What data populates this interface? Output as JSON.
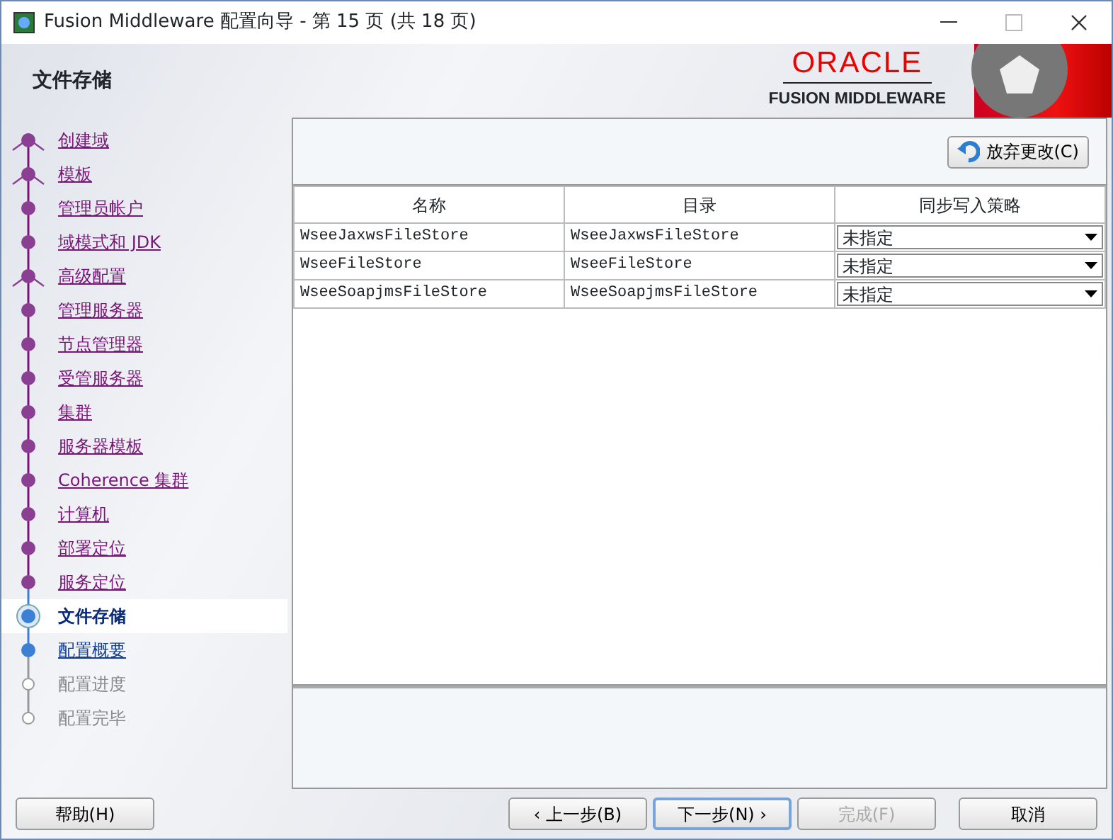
{
  "window": {
    "title": "Fusion Middleware 配置向导 - 第 15 页 (共 18 页)"
  },
  "header": {
    "title": "文件存储",
    "logo_brand": "ORACLE",
    "logo_product": "FUSION MIDDLEWARE"
  },
  "steps": [
    {
      "label": "创建域",
      "kind": "visited",
      "branch": true
    },
    {
      "label": "模板",
      "kind": "visited",
      "branch": true
    },
    {
      "label": "管理员帐户",
      "kind": "visited",
      "branch": false
    },
    {
      "label": "域模式和 JDK",
      "kind": "visited",
      "branch": false
    },
    {
      "label": "高级配置",
      "kind": "visited",
      "branch": true
    },
    {
      "label": "管理服务器",
      "kind": "visited",
      "branch": false
    },
    {
      "label": "节点管理器",
      "kind": "visited",
      "branch": false
    },
    {
      "label": "受管服务器",
      "kind": "visited",
      "branch": false
    },
    {
      "label": "集群",
      "kind": "visited",
      "branch": false
    },
    {
      "label": "服务器模板",
      "kind": "visited",
      "branch": false
    },
    {
      "label": "Coherence 集群",
      "kind": "visited",
      "branch": false
    },
    {
      "label": "计算机",
      "kind": "visited",
      "branch": false
    },
    {
      "label": "部署定位",
      "kind": "visited",
      "branch": false
    },
    {
      "label": "服务定位",
      "kind": "visited",
      "branch": false
    },
    {
      "label": "文件存储",
      "kind": "current",
      "branch": false
    },
    {
      "label": "配置概要",
      "kind": "available",
      "branch": false
    },
    {
      "label": "配置进度",
      "kind": "disabled",
      "branch": false
    },
    {
      "label": "配置完毕",
      "kind": "disabled",
      "branch": false
    }
  ],
  "discard_button": {
    "label": "放弃更改(C)"
  },
  "table": {
    "columns": [
      "名称",
      "目录",
      "同步写入策略"
    ],
    "rows": [
      {
        "name": "WseeJaxwsFileStore",
        "directory": "WseeJaxwsFileStore",
        "policy": "未指定"
      },
      {
        "name": "WseeFileStore",
        "directory": "WseeFileStore",
        "policy": "未指定"
      },
      {
        "name": "WseeSoapjmsFileStore",
        "directory": "WseeSoapjmsFileStore",
        "policy": "未指定"
      }
    ]
  },
  "buttons": [
    {
      "label": "帮助(H)",
      "disabled": false,
      "focused": false
    },
    {
      "label": "‹ 上一步(B)",
      "disabled": false,
      "focused": false
    },
    {
      "label": "下一步(N) ›",
      "disabled": false,
      "focused": true
    },
    {
      "label": "完成(F)",
      "disabled": true,
      "focused": false
    },
    {
      "label": "取消",
      "disabled": false,
      "focused": false
    }
  ]
}
